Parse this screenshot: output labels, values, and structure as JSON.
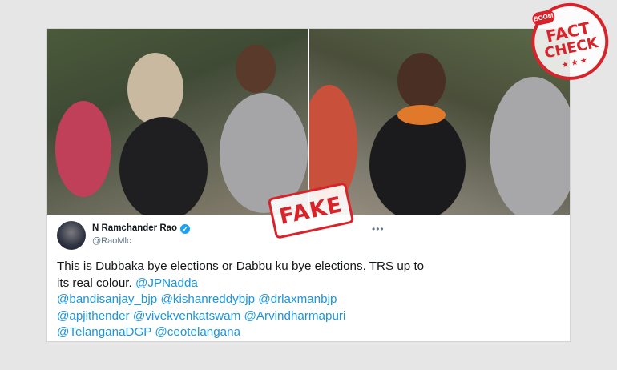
{
  "tweet": {
    "author_name": "N Ramchander Rao",
    "handle": "@RaoMlc",
    "text_plain": "This is Dubbaka bye elections or Dabbu  ku bye elections. TRS up to its real colour.",
    "mentions": [
      "@JPNadda",
      "@bandisanjay_bjp",
      "@kishanreddybjp",
      "@drlaxmanbjp",
      "@apjithender",
      "@vivekvenkatswam",
      "@Arvindharmapuri",
      "@TelanganaDGP",
      "@ceotelangana"
    ],
    "more_icon": "•••"
  },
  "stamp": {
    "label": "FAKE",
    "color": "#d8232a"
  },
  "badge": {
    "brand": "BOOM",
    "word1": "FACT",
    "word2": "CHECK",
    "stars": "★ ★ ★"
  },
  "colors": {
    "mention": "#1b95e0",
    "verified": "#1da1f2",
    "text": "#14171a"
  },
  "icons": {
    "verified": "verified-badge-icon",
    "more": "more-options-icon"
  }
}
